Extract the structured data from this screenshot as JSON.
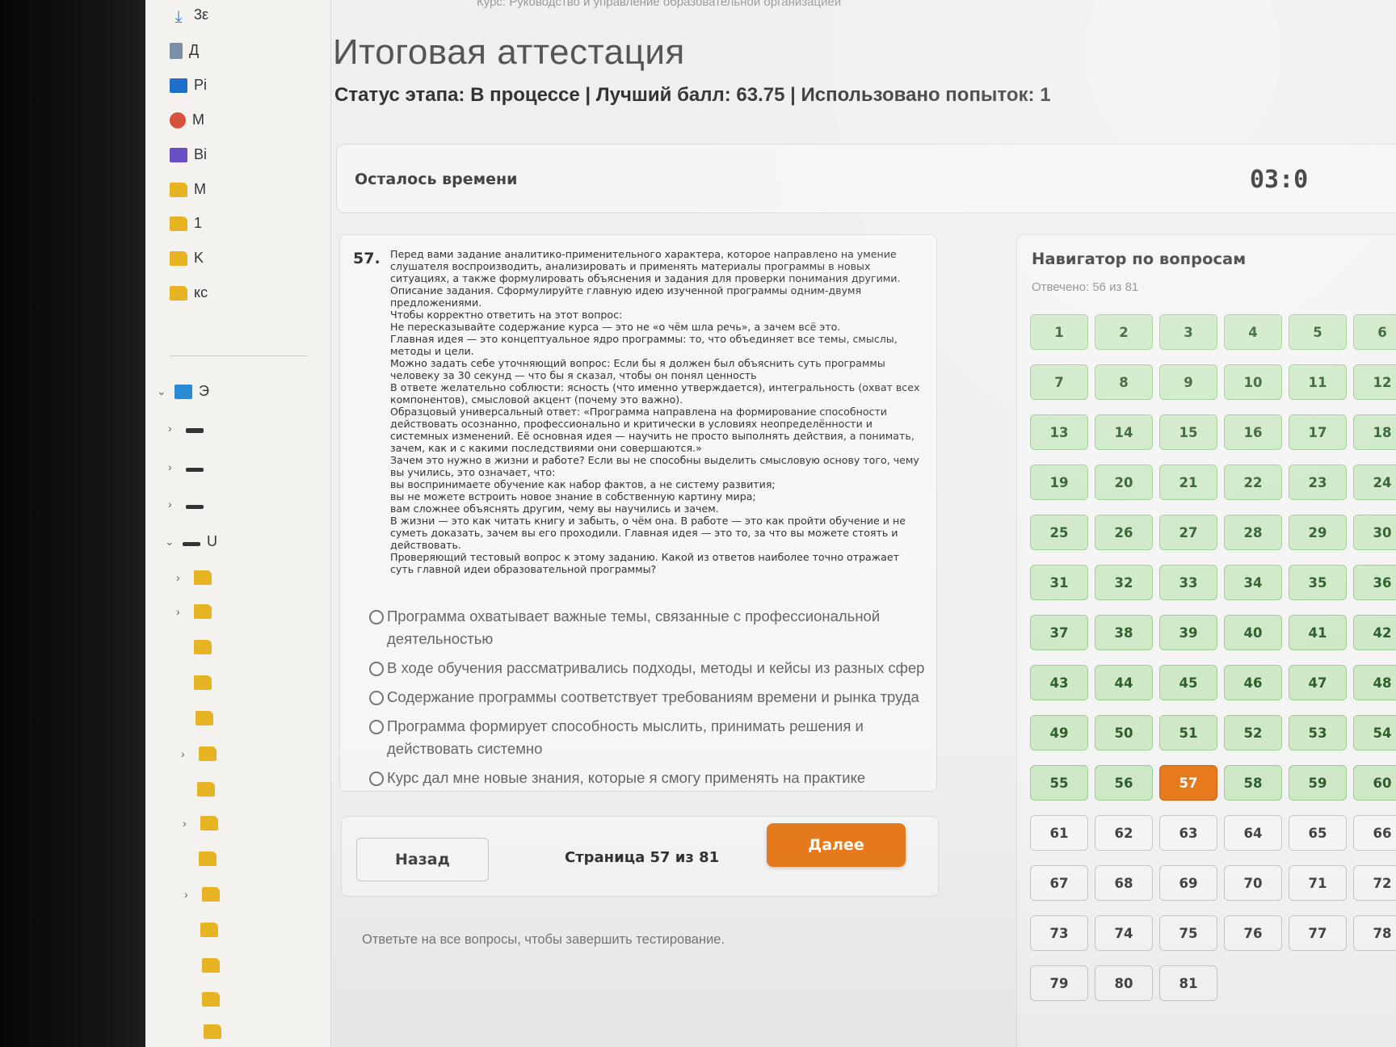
{
  "breadcrumb": "Курс: Руководство и управление образовательной организацией",
  "page": {
    "title": "Итоговая аттестация",
    "status_line": "Статус этапа: В процессе | Лучший балл: 63.75 | Использовано попыток: 1"
  },
  "sidebar": {
    "items": [
      {
        "label": "3ε",
        "icon": "download-icon"
      },
      {
        "label": "Д",
        "icon": "document-icon"
      },
      {
        "label": "Pi",
        "icon": "pictures-icon"
      },
      {
        "label": "M",
        "icon": "music-icon"
      },
      {
        "label": "Bi",
        "icon": "video-icon"
      },
      {
        "label": "M",
        "icon": "folder-icon"
      },
      {
        "label": "1",
        "icon": "folder-icon"
      },
      {
        "label": "K",
        "icon": "folder-icon"
      },
      {
        "label": "кс",
        "icon": "folder-icon"
      },
      {
        "label": "Э",
        "icon": "computer-icon"
      },
      {
        "label": "U",
        "icon": "drive-icon"
      }
    ]
  },
  "timer": {
    "label": "Осталось времени",
    "value": "03:0"
  },
  "question": {
    "number": "57.",
    "text": "Перед вами задание аналитико-применительного характера, которое направлено на умение слушателя воспроизводить, анализировать и применять материалы программы в новых ситуациях, а также формулировать объяснения и задания для проверки понимания другими.\nОписание задания. Сформулируйте главную идею изученной программы одним-двумя предложениями.\nЧтобы корректно ответить на этот вопрос:\nНе пересказывайте содержание курса — это не «о чём шла речь», а зачем всё это.\nГлавная идея — это концептуальное ядро программы: то, что объединяет все темы, смыслы, методы и цели.\nМожно задать себе уточняющий вопрос: Если бы я должен был объяснить суть программы человеку за 30 секунд — что бы я сказал, чтобы он понял ценность\nВ ответе желательно соблюсти: ясность (что именно утверждается), интегральность (охват всех компонентов), смысловой акцент (почему это важно).\nОбразцовый универсальный ответ: «Программа направлена на формирование способности действовать осознанно, профессионально и критически в условиях неопределённости и системных изменений. Её основная идея — научить не просто выполнять действия, а понимать, зачем, как и с какими последствиями они совершаются.»\nЗачем это нужно в жизни и работе? Если вы не способны выделить смысловую основу того, чему вы учились, это означает, что:\nвы воспринимаете обучение как набор фактов, а не систему развития;\nвы не можете встроить новое знание в собственную картину мира;\nвам сложнее объяснять другим, чему вы научились и зачем.\nВ жизни — это как читать книгу и забыть, о чём она. В работе — это как пройти обучение и не суметь доказать, зачем вы его проходили. Главная идея — это то, за что вы можете стоять и действовать.\nПроверяющий тестовый вопрос к этому заданию. Какой из ответов наиболее точно отражает суть главной идеи образовательной программы?",
    "options": [
      "Программа охватывает важные темы, связанные с профессиональной деятельностью",
      "В ходе обучения рассматривались подходы, методы и кейсы из разных сфер",
      "Содержание программы соответствует требованиям времени и рынка труда",
      "Программа формирует способность мыслить, принимать решения и действовать системно",
      "Курс дал мне новые знания, которые я смогу применять на практике"
    ]
  },
  "pager": {
    "back_label": "Назад",
    "page_text": "Страница 57 из 81",
    "next_label": "Далее"
  },
  "completion_hint": "Ответьте на все вопросы, чтобы завершить тестирование.",
  "navigator": {
    "title": "Навигатор по вопросам",
    "progress": "Отвечено: 56 из 81",
    "current": 57,
    "answered_color": "#cfe9c8",
    "current_color": "#e87b1c",
    "unanswered_from": 61,
    "total": 81
  }
}
